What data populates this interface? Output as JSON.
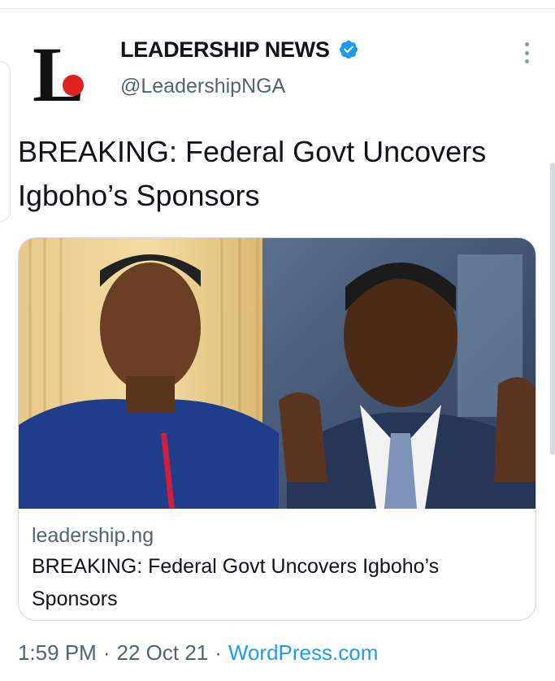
{
  "account": {
    "display_name": "LEADERSHIP NEWS",
    "handle": "@LeadershipNGA",
    "avatar_logo_text": "L"
  },
  "tweet": {
    "text": "BREAKING: Federal Govt Uncovers Igboho’s Sponsors"
  },
  "card": {
    "domain": "leadership.ng",
    "title": "BREAKING: Federal Govt Uncovers Igboho’s Sponsors"
  },
  "meta": {
    "time": "1:59 PM",
    "sep1": "·",
    "date": "22 Oct 21",
    "sep2": "·",
    "source": "WordPress.com"
  },
  "colors": {
    "accent": "#1d9bf0",
    "logo_red": "#e0201e",
    "text_primary": "#0f1419",
    "text_secondary": "#536471"
  },
  "icons": {
    "verified": "verified-badge-icon",
    "more": "more-options-icon"
  }
}
